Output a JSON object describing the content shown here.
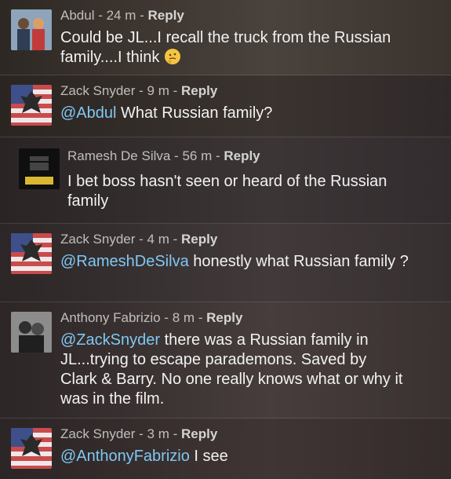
{
  "comments": [
    {
      "author": "Abdul",
      "time": "24 m",
      "reply_label": "Reply",
      "mention": "",
      "text_line": "Could be JL...I recall the truck from the Russian family....I think",
      "emoji": "thinking-face"
    },
    {
      "author": "Zack Snyder",
      "time": "9 m",
      "reply_label": "Reply",
      "mention": "@Abdul",
      "text": " What Russian family?"
    },
    {
      "author": "Ramesh De Silva",
      "time": "56 m",
      "reply_label": "Reply",
      "mention": "",
      "text": "I bet boss hasn't seen or heard of the Russian family"
    },
    {
      "author": "Zack Snyder",
      "time": "4 m",
      "reply_label": "Reply",
      "mention": "@RameshDeSilva",
      "text": " honestly what Russian family ?"
    },
    {
      "author": "Anthony Fabrizio",
      "time": "8 m",
      "reply_label": "Reply",
      "mention": "@ZackSnyder",
      "text": " there was a Russian family in JL...trying to escape parademons. Saved by Clark & Barry. No one really knows what or why it was in the film."
    },
    {
      "author": "Zack Snyder",
      "time": "3 m",
      "reply_label": "Reply",
      "mention": "@AnthonyFabrizio",
      "text": " I see"
    }
  ],
  "separator": " - ",
  "colors": {
    "mention": "#7fc8f4",
    "text": "#f2f2f2",
    "meta": "#d6d6d6"
  }
}
